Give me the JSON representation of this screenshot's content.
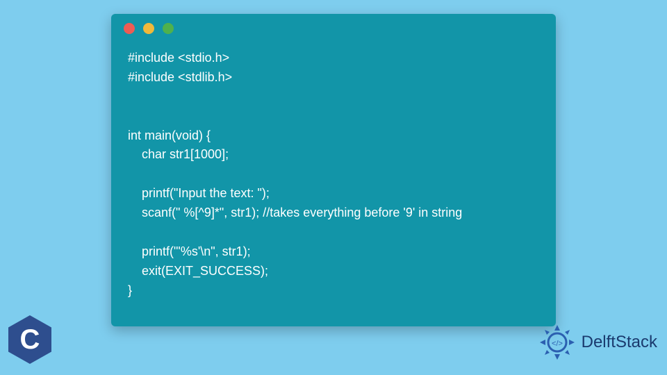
{
  "window": {
    "dots": {
      "red": "#ee5c54",
      "yellow": "#f0b93a",
      "green": "#4fb14c"
    }
  },
  "code": {
    "lines": [
      "#include <stdio.h>",
      "#include <stdlib.h>",
      "",
      "",
      "int main(void) {",
      "    char str1[1000];",
      "",
      "    printf(\"Input the text: \");",
      "    scanf(\" %[^9]*\", str1); //takes everything before '9' in string",
      "",
      "    printf(\"'%s'\\n\", str1);",
      "    exit(EXIT_SUCCESS);",
      "}"
    ]
  },
  "logos": {
    "c_letter": "C",
    "delft_label": "DelftStack"
  },
  "colors": {
    "page_bg": "#7ecdee",
    "window_bg": "#1295a8",
    "code_text": "#ffffff",
    "c_hex": "#2e4e8e",
    "delft_text": "#1a3a6e",
    "delft_badge": "#2b5fb0"
  }
}
